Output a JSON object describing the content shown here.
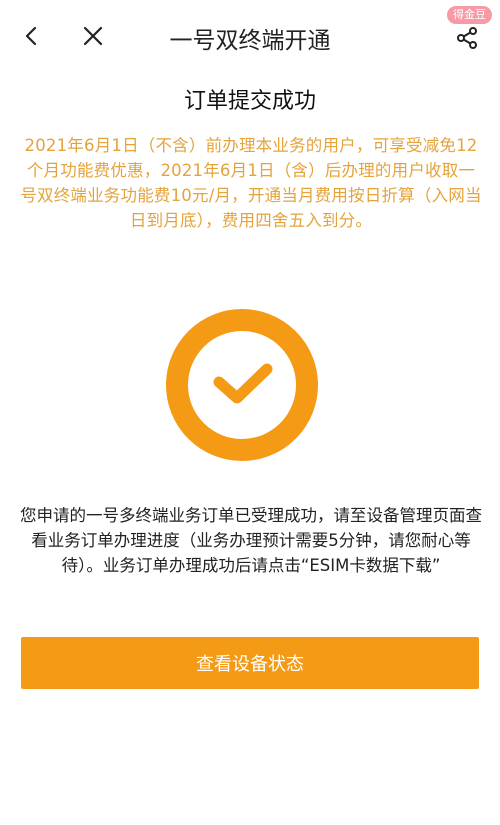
{
  "header": {
    "title": "一号双终端开通",
    "badge": "得金豆",
    "back_icon": "chevron-left-icon",
    "close_icon": "close-icon",
    "share_icon": "share-icon"
  },
  "result": {
    "heading": "订单提交成功",
    "notice": "2021年6月1日（不含）前办理本业务的用户，可享受减免12个月功能费优惠，2021年6月1日（含）后办理的用户收取一号双终端业务功能费10元/月，开通当月费用按日折算（入网当日到月底），费用四舍五入到分。",
    "status_icon": "checkmark-circle-icon",
    "message": "您申请的一号多终端业务订单已受理成功，请至设备管理页面查看业务订单办理进度（业务办理预计需要5分钟，请您耐心等待）。业务订单办理成功后请点击“ESIM卡数据下载”"
  },
  "actions": {
    "view_status_label": "查看设备状态"
  },
  "colors": {
    "accent": "#f59a14",
    "notice_text": "#e5a33b",
    "badge_bg": "#f59aa6"
  }
}
